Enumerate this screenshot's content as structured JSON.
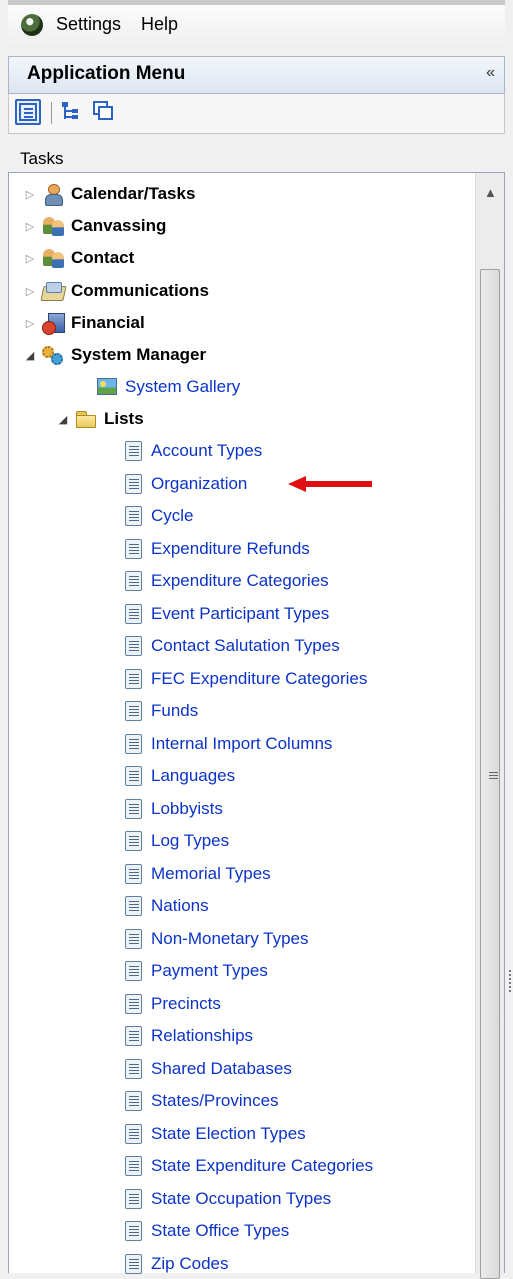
{
  "menubar": {
    "items": [
      "Settings",
      "Help"
    ]
  },
  "panel": {
    "title": "Application Menu",
    "collapse_glyph": "«"
  },
  "toolbar": {
    "buttons": [
      "tree-view-icon",
      "hierarchy-icon",
      "windows-icon"
    ]
  },
  "tasks_label": "Tasks",
  "tree": {
    "top_level": [
      {
        "label": "Calendar/Tasks",
        "icon": "person-icon",
        "expanded": false
      },
      {
        "label": "Canvassing",
        "icon": "people-icon",
        "expanded": false
      },
      {
        "label": "Contact",
        "icon": "people-icon",
        "expanded": false
      },
      {
        "label": "Communications",
        "icon": "communications-icon",
        "expanded": false
      },
      {
        "label": "Financial",
        "icon": "financial-icon",
        "expanded": false
      },
      {
        "label": "System Manager",
        "icon": "gears-icon",
        "expanded": true
      }
    ],
    "system_manager_children": {
      "gallery": "System Gallery",
      "lists_folder": "Lists"
    },
    "lists": [
      "Account Types",
      "Organization",
      "Cycle",
      "Expenditure Refunds",
      "Expenditure Categories",
      "Event Participant Types",
      "Contact Salutation Types",
      "FEC Expenditure Categories",
      "Funds",
      "Internal Import Columns",
      "Languages",
      "Lobbyists",
      "Log Types",
      "Memorial Types",
      "Nations",
      "Non-Monetary Types",
      "Payment Types",
      "Precincts",
      "Relationships",
      "Shared Databases",
      "States/Provinces",
      "State Election Types",
      "State Expenditure Categories",
      "State Occupation Types",
      "State Office Types",
      "Zip Codes"
    ]
  },
  "colors": {
    "link": "#0c33c7",
    "annotation_arrow": "#e01010"
  }
}
